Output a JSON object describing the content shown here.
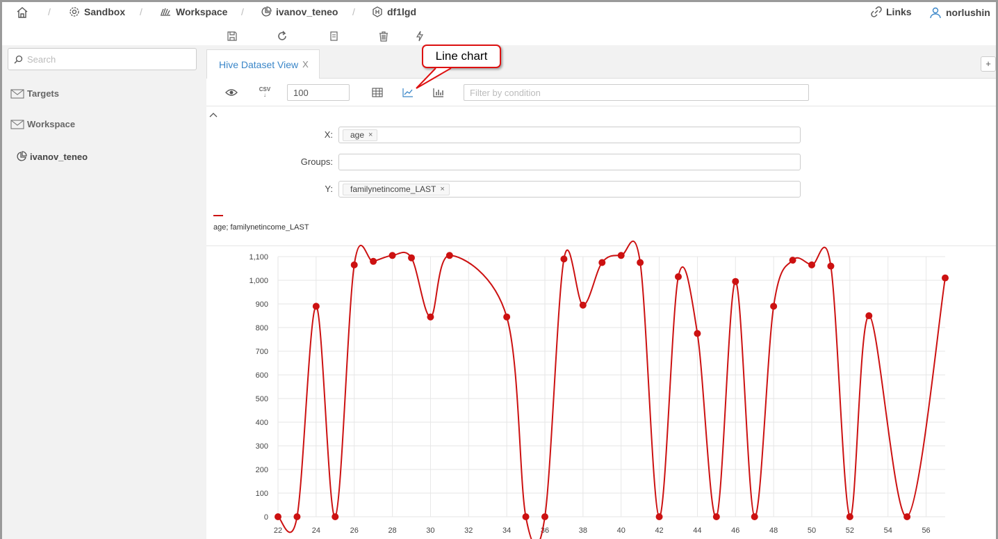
{
  "breadcrumb": {
    "items": [
      {
        "label": "Sandbox",
        "icon": "gear-icon"
      },
      {
        "label": "Workspace",
        "icon": "hand-icon"
      },
      {
        "label": "ivanov_teneo",
        "icon": "pie-icon"
      },
      {
        "label": "df1lgd",
        "icon": "hive-icon"
      }
    ],
    "separator": "/"
  },
  "header_right": {
    "links_label": "Links",
    "user_label": "norlushin"
  },
  "sidebar": {
    "search_placeholder": "Search",
    "items": [
      {
        "label": "Targets"
      },
      {
        "label": "Workspace"
      },
      {
        "label": "ivanov_teneo"
      }
    ]
  },
  "tabs": [
    {
      "label": "Hive Dataset View",
      "close": "X"
    }
  ],
  "add_tab_label": "+",
  "view_toolbar": {
    "csv_label": "CSV",
    "limit_value": "100",
    "filter_placeholder": "Filter by condition"
  },
  "config": {
    "x_label": "X:",
    "groups_label": "Groups:",
    "y_label": "Y:",
    "x_tag": "age",
    "y_tag": "familynetincome_LAST",
    "tag_close": "×"
  },
  "callout": {
    "text": "Line chart"
  },
  "chart_data": {
    "type": "line",
    "legend": "age; familynetincome_LAST",
    "series": [
      {
        "color": "#cc1111",
        "x": [
          22,
          23,
          24,
          25,
          26,
          27,
          28,
          29,
          30,
          31,
          34,
          35,
          36,
          37,
          38,
          39,
          40,
          41,
          42,
          43,
          44,
          45,
          46,
          47,
          48,
          49,
          50,
          51,
          52,
          53,
          55,
          57
        ],
        "values": [
          0,
          0,
          890,
          0,
          1065,
          1080,
          1105,
          1095,
          845,
          1105,
          845,
          0,
          0,
          1090,
          895,
          1075,
          1105,
          1075,
          0,
          1015,
          775,
          0,
          995,
          0,
          890,
          1085,
          1065,
          1060,
          0,
          850,
          0,
          1010
        ]
      }
    ],
    "xlim": [
      22,
      57
    ],
    "ylim": [
      0,
      1100
    ],
    "x_ticks": [
      22,
      24,
      26,
      28,
      30,
      32,
      34,
      36,
      38,
      40,
      42,
      44,
      46,
      48,
      50,
      52,
      54,
      56
    ],
    "y_ticks": [
      0,
      100,
      200,
      300,
      400,
      500,
      600,
      700,
      800,
      900,
      1000,
      1100
    ],
    "y_tick_labels": [
      "0",
      "100",
      "200",
      "300",
      "400",
      "500",
      "600",
      "700",
      "800",
      "900",
      "1,000",
      "1,100"
    ],
    "grid": true
  }
}
